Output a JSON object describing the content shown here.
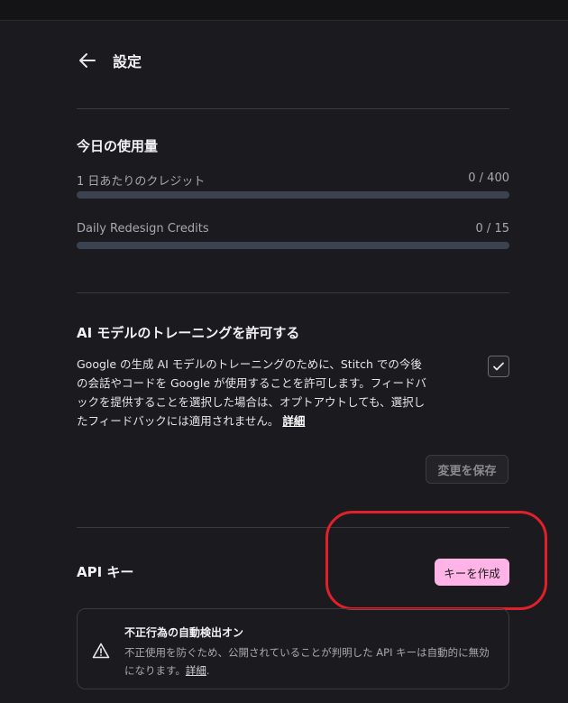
{
  "header": {
    "title": "設定"
  },
  "usage": {
    "title": "今日の使用量",
    "rows": [
      {
        "label": "1 日あたりのクレジット",
        "value": "0 / 400",
        "fraction": 0
      },
      {
        "label": "Daily Redesign Credits",
        "value": "0 / 15",
        "fraction": 0
      }
    ]
  },
  "ai_training": {
    "title": "AI モデルのトレーニングを許可する",
    "description": "Google の生成 AI モデルのトレーニングのために、Stitch での今後の会話やコードを Google が使用することを許可します。フィードバックを提供することを選択した場合は、オプトアウトしても、選択したフィードバックには適用されません。",
    "link": "詳細",
    "checked": true,
    "save_label": "変更を保存"
  },
  "api": {
    "title": "API キー",
    "create_label": "キーを作成",
    "accent": "#ffb3e6",
    "notice": {
      "title": "不正行為の自動検出オン",
      "description": "不正使用を防ぐため、公開されていることが判明した API キーは自動的に無効になります。",
      "link": "詳細",
      "icon": "warning-icon"
    }
  }
}
